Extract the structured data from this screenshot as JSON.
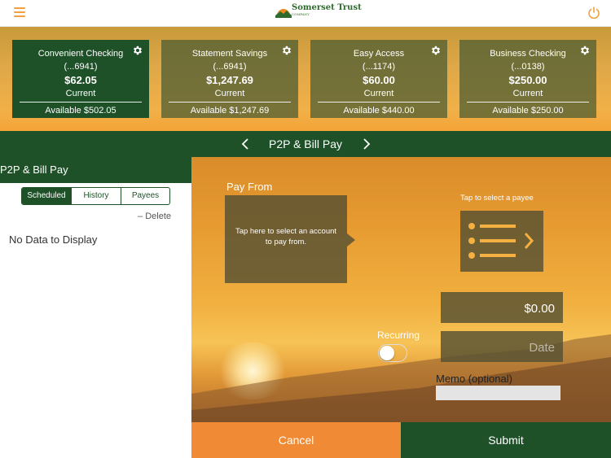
{
  "app": {
    "logo_text": "Somerset Trust",
    "logo_subtext": "COMPANY"
  },
  "colors": {
    "brand_green": "#1e5128",
    "accent_orange": "#f08a34"
  },
  "accounts": [
    {
      "name": "Convenient Checking",
      "number": "(...6941)",
      "balance": "$62.05",
      "balance_label": "Current",
      "available": "Available $502.05"
    },
    {
      "name": "Statement Savings",
      "number": "(...6941)",
      "balance": "$1,247.69",
      "balance_label": "Current",
      "available": "Available $1,247.69"
    },
    {
      "name": "Easy Access",
      "number": "(...1174)",
      "balance": "$60.00",
      "balance_label": "Current",
      "available": "Available $440.00"
    },
    {
      "name": "Business Checking",
      "number": "(...0138)",
      "balance": "$250.00",
      "balance_label": "Current",
      "available": "Available $250.00"
    }
  ],
  "nav": {
    "title": "P2P & Bill Pay"
  },
  "left_panel": {
    "header": "P2P & Bill Pay",
    "tabs": [
      "Scheduled",
      "History",
      "Payees"
    ],
    "selected_tab": "Scheduled",
    "delete_label": "– Delete",
    "empty_text": "No Data to Display"
  },
  "payment": {
    "pay_from_label": "Pay From",
    "pay_from_hint": "Tap here to select an account to pay from.",
    "payee_hint": "Tap to select a payee",
    "amount_value": "$0.00",
    "date_placeholder": "Date",
    "recurring_label": "Recurring",
    "recurring_on": false,
    "memo_label": "Memo (optional)",
    "memo_value": ""
  },
  "actions": {
    "cancel_label": "Cancel",
    "submit_label": "Submit"
  },
  "icons": {
    "menu": "hamburger-icon",
    "power": "power-icon",
    "settings": "gear-icon",
    "payee_list": "list-chevron-icon"
  }
}
